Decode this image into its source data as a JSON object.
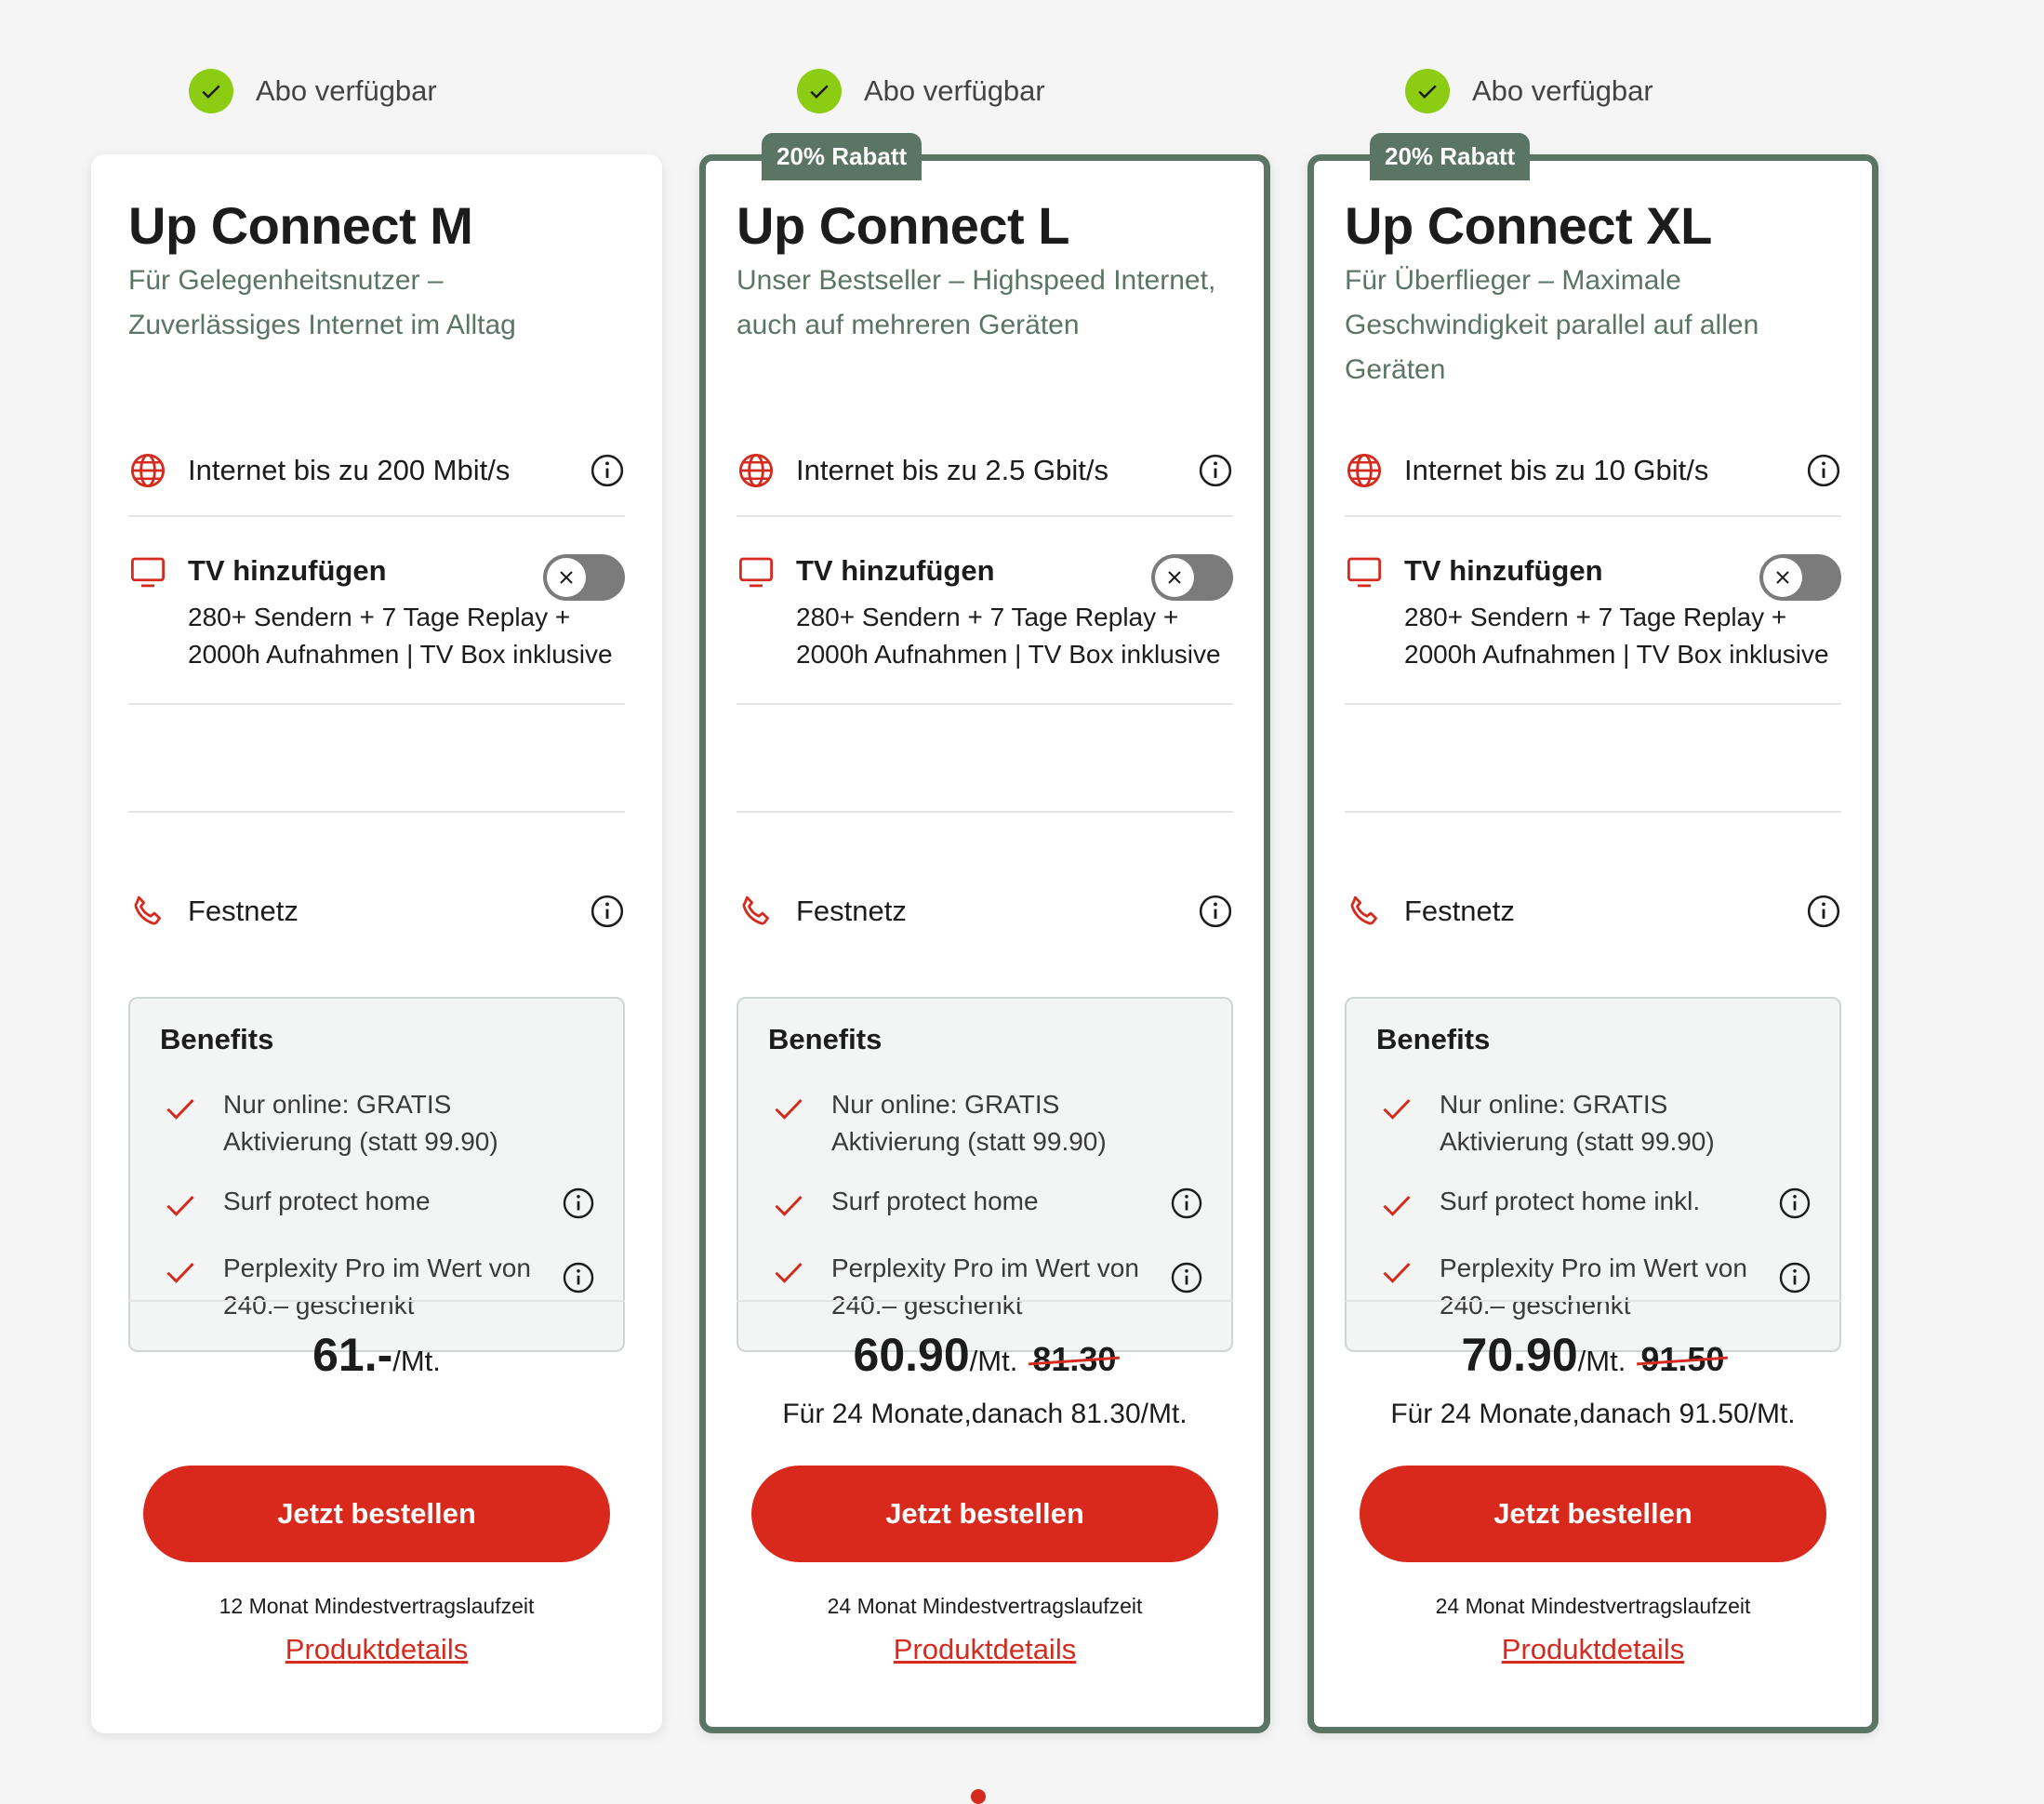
{
  "availability_label": "Abo verfügbar",
  "colors": {
    "accent_red": "#d9291c",
    "highlight_green": "#5b7565",
    "check_green": "#8ccc13"
  },
  "cards": [
    {
      "title": "Up Connect M",
      "subtitle": "Für Gelegenheitsnutzer – Zuverlässiges Internet im Alltag",
      "badge": "",
      "internet": "Internet bis zu 200 Mbit/s",
      "tv_label": "TV hinzufügen",
      "tv_desc": "280+ Sendern + 7 Tage Replay + 2000h Aufnahmen | TV Box inklusive",
      "phone": "Festnetz",
      "benefits_title": "Benefits",
      "benefits": [
        "Nur online: GRATIS Aktivierung (statt 99.90)",
        "Surf protect home",
        "Perplexity Pro im Wert von 240.– geschenkt"
      ],
      "price": "61.-",
      "unit": "/Mt.",
      "old_price": "",
      "price_note": "",
      "order": "Jetzt bestellen",
      "min_term": "12 Monat Mindestvertragslaufzeit",
      "details": "Produktdetails"
    },
    {
      "title": "Up Connect L",
      "subtitle": "Unser Bestseller – Highspeed Internet, auch auf mehreren Geräten",
      "badge": "20% Rabatt",
      "internet": "Internet bis zu 2.5 Gbit/s",
      "tv_label": "TV hinzufügen",
      "tv_desc": "280+ Sendern + 7 Tage Replay + 2000h Aufnahmen | TV Box inklusive",
      "phone": "Festnetz",
      "benefits_title": "Benefits",
      "benefits": [
        "Nur online: GRATIS Aktivierung (statt 99.90)",
        "Surf protect home",
        "Perplexity Pro im Wert von 240.– geschenkt"
      ],
      "price": "60.90",
      "unit": "/Mt.",
      "old_price": "81.30",
      "price_note": "Für 24 Monate,danach 81.30/Mt.",
      "order": "Jetzt bestellen",
      "min_term": "24 Monat Mindestvertragslaufzeit",
      "details": "Produktdetails"
    },
    {
      "title": "Up Connect XL",
      "subtitle": "Für Überflieger – Maximale Geschwindigkeit parallel auf allen Geräten",
      "badge": "20% Rabatt",
      "internet": "Internet bis zu 10 Gbit/s",
      "tv_label": "TV hinzufügen",
      "tv_desc": "280+ Sendern + 7 Tage Replay + 2000h Aufnahmen | TV Box inklusive",
      "phone": "Festnetz",
      "benefits_title": "Benefits",
      "benefits": [
        "Nur online: GRATIS Aktivierung (statt 99.90)",
        "Surf protect home inkl.",
        "Perplexity Pro im Wert von 240.– geschenkt"
      ],
      "price": "70.90",
      "unit": "/Mt.",
      "old_price": "91.50",
      "price_note": "Für 24 Monate,danach 91.50/Mt.",
      "order": "Jetzt bestellen",
      "min_term": "24 Monat Mindestvertragslaufzeit",
      "details": "Produktdetails"
    }
  ]
}
